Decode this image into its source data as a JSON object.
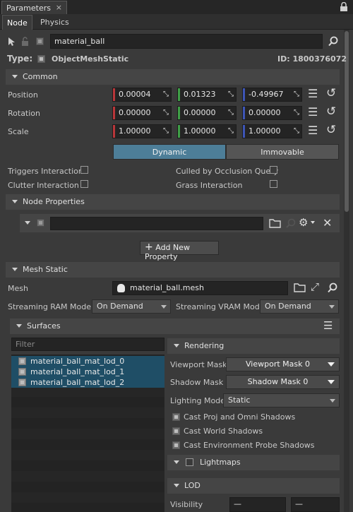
{
  "window": {
    "title": "Parameters",
    "close": "×"
  },
  "tabs": [
    {
      "label": "Node"
    },
    {
      "label": "Physics"
    }
  ],
  "node": {
    "name": "material_ball",
    "type_label": "Type:",
    "type_value": "ObjectMeshStatic",
    "id": "ID: 1800376072"
  },
  "common": {
    "title": "Common",
    "rows": [
      {
        "label": "Position",
        "x": "0.00004",
        "y": "0.01323",
        "z": "-0.49967"
      },
      {
        "label": "Rotation",
        "x": "0.00000",
        "y": "0.00000",
        "z": "0.00000"
      },
      {
        "label": "Scale",
        "x": "1.00000",
        "y": "1.00000",
        "z": "1.00000"
      }
    ],
    "toggle": {
      "dynamic": "Dynamic",
      "immovable": "Immovable",
      "active": "Dynamic"
    },
    "flags": {
      "triggers": "Triggers Interaction",
      "culled": "Culled by Occlusion Query",
      "clutter": "Clutter Interaction",
      "grass": "Grass Interaction"
    }
  },
  "node_properties": {
    "title": "Node Properties",
    "add": "Add New Property"
  },
  "mesh_static": {
    "title": "Mesh Static",
    "mesh_label": "Mesh",
    "mesh_value": "material_ball.mesh",
    "ram_label": "Streaming RAM Mode",
    "ram_value": "On Demand",
    "vram_label": "Streaming VRAM Mode",
    "vram_value": "On Demand"
  },
  "surfaces": {
    "title": "Surfaces",
    "filter_placeholder": "Filter",
    "items": [
      "material_ball_mat_lod_0",
      "material_ball_mat_lod_1",
      "material_ball_mat_lod_2"
    ]
  },
  "rendering": {
    "title": "Rendering",
    "viewport_mask_label": "Viewport Mask",
    "viewport_mask_value": "Viewport Mask 0",
    "shadow_mask_label": "Shadow Mask",
    "shadow_mask_value": "Shadow Mask 0",
    "lighting_mode_label": "Lighting Mode",
    "lighting_mode_value": "Static",
    "cast_proj": "Cast Proj and Omni Shadows",
    "cast_world": "Cast World Shadows",
    "cast_env": "Cast Environment Probe Shadows"
  },
  "lightmaps": {
    "title": "Lightmaps"
  },
  "lod": {
    "title": "LOD",
    "visibility_label": "Visibility",
    "visibility_a": "—",
    "visibility_b": "—"
  },
  "colors": {
    "x_axis": "#b9363a",
    "y_axis": "#3f9f47",
    "z_axis": "#3d55b6",
    "accent": "#4d7e98",
    "selection": "#1f4e66"
  }
}
